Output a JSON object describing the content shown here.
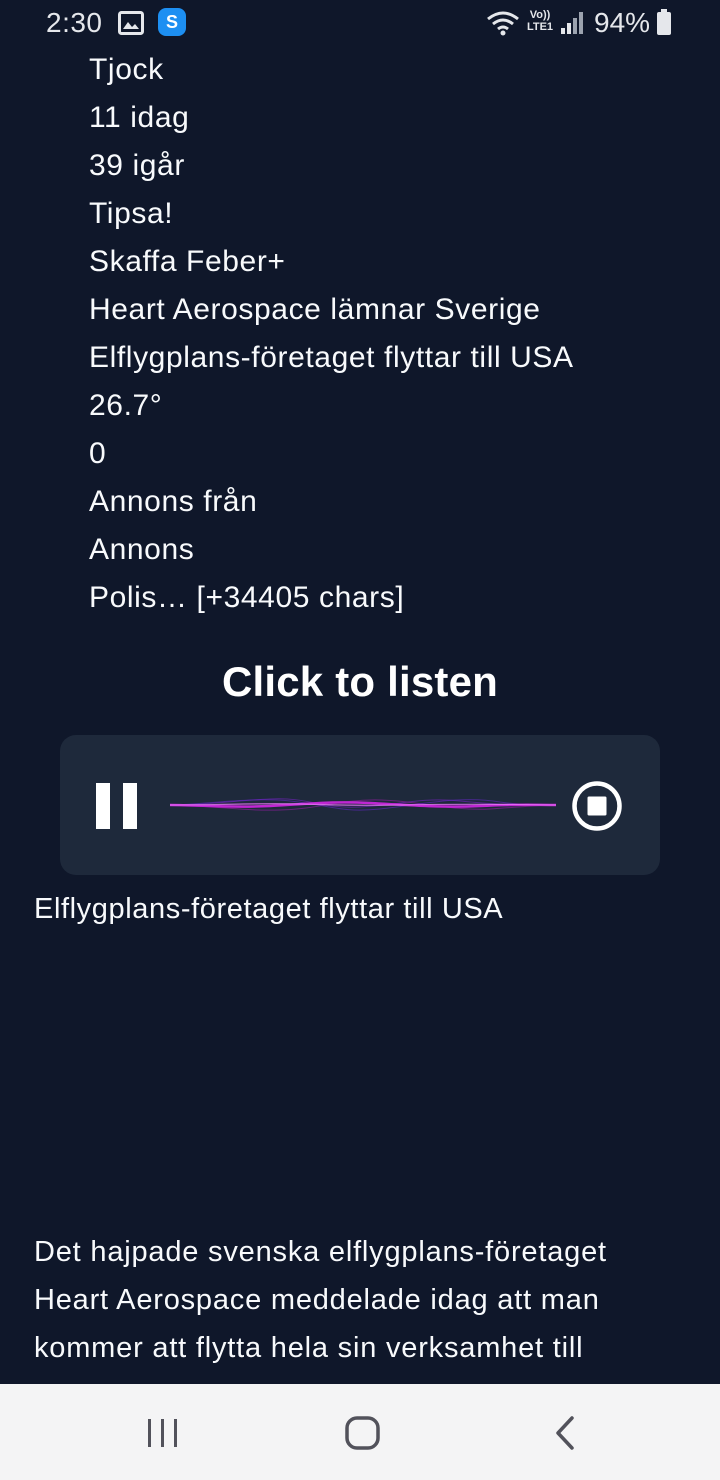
{
  "status_bar": {
    "time": "2:30",
    "lte_label_top": "Vo))",
    "lte_label_bottom": "LTE1",
    "app_badge": "S",
    "battery": "94%"
  },
  "content_lines": [
    "Tjock",
    "11 idag",
    "39 igår",
    "Tipsa!",
    "Skaffa Feber+",
    "Heart Aerospace lämnar Sverige",
    "Elflygplans-företaget flyttar till USA",
    "26.7°",
    "0",
    "Annons från",
    "Annons",
    "Polis… [+34405 chars]"
  ],
  "player": {
    "title": "Click to listen",
    "accent_color": "#c026d3"
  },
  "subtitle": "Elflygplans-företaget flyttar till USA",
  "article_lines": [
    "Det hajpade svenska elflygplans-företaget",
    "Heart Aerospace meddelade idag att man",
    "kommer att flytta hela sin verksamhet till"
  ],
  "colors": {
    "background": "#0f172a",
    "player_background": "#1e293b",
    "nav_background": "#f4f4f5"
  }
}
